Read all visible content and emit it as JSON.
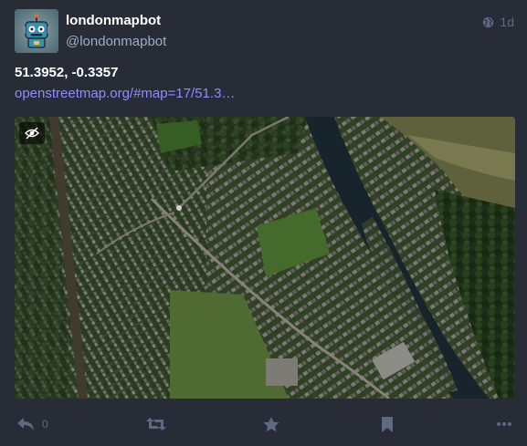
{
  "account": {
    "display_name": "londonmapbot",
    "handle": "@londonmapbot",
    "avatar_icon": "robot-icon"
  },
  "meta": {
    "visibility_icon": "globe-icon",
    "timestamp": "1d"
  },
  "content": {
    "coordinates": "51.3952, -0.3357",
    "link_text": "openstreetmap.org/#map=17/51.3…"
  },
  "media": {
    "type": "satellite-image",
    "hide_media_icon": "eye-slash-icon"
  },
  "actions": {
    "reply_count": "0",
    "reply_icon": "reply-icon",
    "boost_icon": "retweet-icon",
    "favourite_icon": "star-icon",
    "bookmark_icon": "bookmark-icon",
    "more_icon": "ellipsis-icon"
  },
  "colors": {
    "background": "#282c37",
    "link": "#8c8dff",
    "muted": "#606984",
    "handle": "#9baec8"
  }
}
